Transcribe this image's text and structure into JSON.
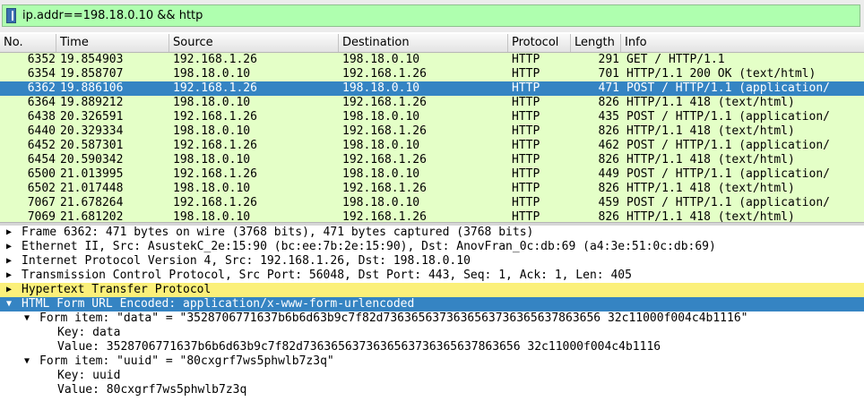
{
  "filter": {
    "value": "ip.addr==198.18.0.10 && http"
  },
  "packet_list": {
    "columns": [
      "No.",
      "Time",
      "Source",
      "Destination",
      "Protocol",
      "Length",
      "Info"
    ],
    "rows": [
      {
        "no": "6352",
        "time": "19.854903",
        "src": "192.168.1.26",
        "dst": "198.18.0.10",
        "proto": "HTTP",
        "len": "291",
        "info": "GET / HTTP/1.1",
        "selected": false
      },
      {
        "no": "6354",
        "time": "19.858707",
        "src": "198.18.0.10",
        "dst": "192.168.1.26",
        "proto": "HTTP",
        "len": "701",
        "info": "HTTP/1.1 200 OK  (text/html)",
        "selected": false
      },
      {
        "no": "6362",
        "time": "19.886106",
        "src": "192.168.1.26",
        "dst": "198.18.0.10",
        "proto": "HTTP",
        "len": "471",
        "info": "POST / HTTP/1.1  (application/",
        "selected": true
      },
      {
        "no": "6364",
        "time": "19.889212",
        "src": "198.18.0.10",
        "dst": "192.168.1.26",
        "proto": "HTTP",
        "len": "826",
        "info": "HTTP/1.1 418   (text/html)",
        "selected": false
      },
      {
        "no": "6438",
        "time": "20.326591",
        "src": "192.168.1.26",
        "dst": "198.18.0.10",
        "proto": "HTTP",
        "len": "435",
        "info": "POST / HTTP/1.1  (application/",
        "selected": false
      },
      {
        "no": "6440",
        "time": "20.329334",
        "src": "198.18.0.10",
        "dst": "192.168.1.26",
        "proto": "HTTP",
        "len": "826",
        "info": "HTTP/1.1 418   (text/html)",
        "selected": false
      },
      {
        "no": "6452",
        "time": "20.587301",
        "src": "192.168.1.26",
        "dst": "198.18.0.10",
        "proto": "HTTP",
        "len": "462",
        "info": "POST / HTTP/1.1  (application/",
        "selected": false
      },
      {
        "no": "6454",
        "time": "20.590342",
        "src": "198.18.0.10",
        "dst": "192.168.1.26",
        "proto": "HTTP",
        "len": "826",
        "info": "HTTP/1.1 418   (text/html)",
        "selected": false
      },
      {
        "no": "6500",
        "time": "21.013995",
        "src": "192.168.1.26",
        "dst": "198.18.0.10",
        "proto": "HTTP",
        "len": "449",
        "info": "POST / HTTP/1.1  (application/",
        "selected": false
      },
      {
        "no": "6502",
        "time": "21.017448",
        "src": "198.18.0.10",
        "dst": "192.168.1.26",
        "proto": "HTTP",
        "len": "826",
        "info": "HTTP/1.1 418   (text/html)",
        "selected": false
      },
      {
        "no": "7067",
        "time": "21.678264",
        "src": "192.168.1.26",
        "dst": "198.18.0.10",
        "proto": "HTTP",
        "len": "459",
        "info": "POST / HTTP/1.1  (application/",
        "selected": false
      },
      {
        "no": "7069",
        "time": "21.681202",
        "src": "198.18.0.10",
        "dst": "192.168.1.26",
        "proto": "HTTP",
        "len": "826",
        "info": "HTTP/1.1 418   (text/html)",
        "selected": false
      }
    ]
  },
  "details": [
    {
      "indent": 0,
      "arrow": "collapsed",
      "text": "Frame 6362: 471 bytes on wire (3768 bits), 471 bytes captured (3768 bits)",
      "style": ""
    },
    {
      "indent": 0,
      "arrow": "collapsed",
      "text": "Ethernet II, Src: AsustekC_2e:15:90 (bc:ee:7b:2e:15:90), Dst: AnovFran_0c:db:69 (a4:3e:51:0c:db:69)",
      "style": ""
    },
    {
      "indent": 0,
      "arrow": "collapsed",
      "text": "Internet Protocol Version 4, Src: 192.168.1.26, Dst: 198.18.0.10",
      "style": ""
    },
    {
      "indent": 0,
      "arrow": "collapsed",
      "text": "Transmission Control Protocol, Src Port: 56048, Dst Port: 443, Seq: 1, Ack: 1, Len: 405",
      "style": ""
    },
    {
      "indent": 0,
      "arrow": "collapsed",
      "text": "Hypertext Transfer Protocol",
      "style": "yellow"
    },
    {
      "indent": 0,
      "arrow": "expanded",
      "text": "HTML Form URL Encoded: application/x-www-form-urlencoded",
      "style": "selected"
    },
    {
      "indent": 1,
      "arrow": "expanded",
      "text": "Form item: \"data\" = \"3528706771637b6b6d63b9c7f82d7363656373636563736365637863656 32c11000f004c4b1116\"",
      "style": ""
    },
    {
      "indent": 2,
      "arrow": "none",
      "text": "Key: data",
      "style": ""
    },
    {
      "indent": 2,
      "arrow": "none",
      "text": "Value: 3528706771637b6b6d63b9c7f82d7363656373636563736365637863656 32c11000f004c4b1116",
      "style": ""
    },
    {
      "indent": 1,
      "arrow": "expanded",
      "text": "Form item: \"uuid\" = \"80cxgrf7ws5phwlb7z3q\"",
      "style": ""
    },
    {
      "indent": 2,
      "arrow": "none",
      "text": "Key: uuid",
      "style": ""
    },
    {
      "indent": 2,
      "arrow": "none",
      "text": "Value: 80cxgrf7ws5phwlb7z3q",
      "style": ""
    }
  ]
}
